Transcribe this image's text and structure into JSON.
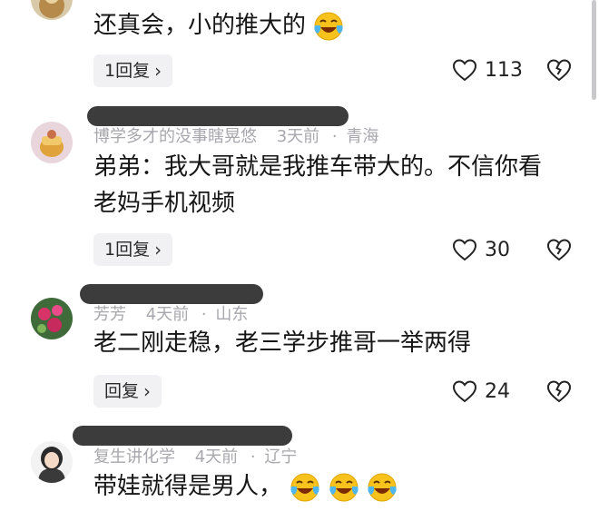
{
  "comments": [
    {
      "id": "c0",
      "username": "",
      "time": "",
      "location": "",
      "text": "还真会，小的推大的",
      "emoji_count": 1,
      "reply_label": "1回复",
      "likes": "113"
    },
    {
      "id": "c1",
      "username": "博学多才的没事瞎晃悠",
      "time": "3天前",
      "location": "青海",
      "text_lines": [
        "弟弟：我大哥就是我推车带大的。不信你看",
        "老妈手机视频"
      ],
      "reply_label": "1回复",
      "likes": "30"
    },
    {
      "id": "c2",
      "username": "芳芳",
      "time": "4天前",
      "location": "山东",
      "text": "老二刚走稳，老三学步推哥一举两得",
      "reply_label": "回复",
      "likes": "24"
    },
    {
      "id": "c3",
      "username": "复生讲化学",
      "time": "4天前",
      "location": "辽宁",
      "text": "带娃就得是男人，",
      "emoji_count": 3
    }
  ],
  "icons": {
    "heart": "heart-icon",
    "dislike": "broken-heart-icon",
    "chevron": "chevron-right-icon",
    "emoji": "laughing-crying-emoji-icon"
  },
  "separator": "·"
}
